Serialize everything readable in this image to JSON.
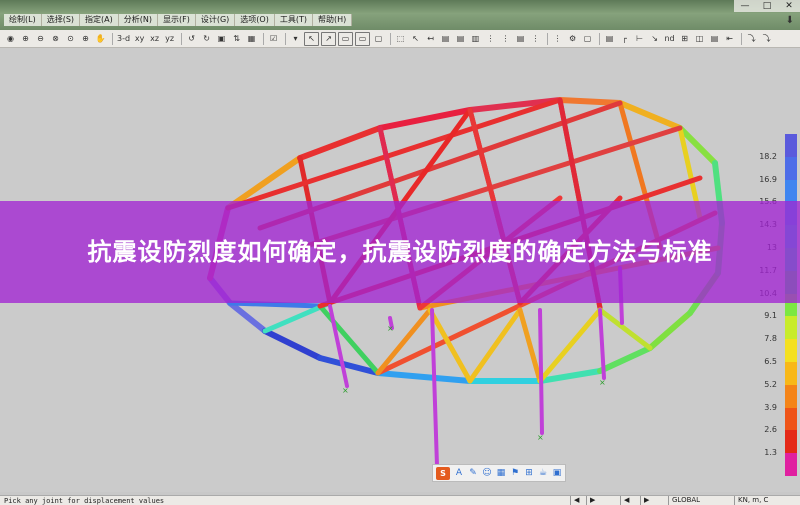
{
  "menubar": {
    "items": [
      "绘制(L)",
      "选择(S)",
      "指定(A)",
      "分析(N)",
      "显示(F)",
      "设计(G)",
      "选项(O)",
      "工具(T)",
      "帮助(H)"
    ],
    "window_controls": [
      "—",
      "□",
      "✕"
    ],
    "download_icon": "download-icon"
  },
  "toolbar": {
    "items": [
      "◉",
      "⊕",
      "⊖",
      "⊗",
      "⊙",
      "⊕",
      "✋",
      "3-d",
      "xy",
      "xz",
      "yz",
      "↺",
      "↻",
      "▣",
      "⇅",
      "▦",
      "☑",
      "▾",
      "↖",
      "↗",
      "▭",
      "▭",
      "▢",
      "⬚",
      "↖",
      "↤",
      "▤",
      "▤",
      "▥",
      "⋮",
      "⋮",
      "▤",
      "⋮",
      "⋮",
      "⚙",
      "▢",
      "▤",
      "┌",
      "⊢",
      "↘",
      "nd",
      "⊞",
      "◫",
      "▤",
      "⇤",
      "⤵",
      "⤵"
    ],
    "view_labels": [
      "3-d",
      "xy",
      "xz",
      "yz"
    ]
  },
  "legend": {
    "values": [
      "18.2",
      "16.9",
      "15.6",
      "14.3",
      "13",
      "11.7",
      "10.4",
      "9.1",
      "7.8",
      "6.5",
      "5.2",
      "3.9",
      "2.6",
      "1.3"
    ],
    "colors": [
      "#5a5adc",
      "#4d6de8",
      "#3f86f0",
      "#2aa2f0",
      "#20c2e0",
      "#28d8b0",
      "#40e070",
      "#7ce840",
      "#c8ec2a",
      "#f4e020",
      "#f8b818",
      "#f48418",
      "#ee5418",
      "#e42818",
      "#e020a0"
    ]
  },
  "banner": {
    "text": "抗震设防烈度如何确定，抗震设防烈度的确定方法与标准"
  },
  "status": {
    "message": "Pick any joint for displacement values",
    "coord_system": "GLOBAL",
    "units": "KN, m, C",
    "nav_arrows": [
      "◀",
      "▶",
      "◀",
      "▶"
    ]
  },
  "minibar": {
    "logo": "S",
    "icons": [
      "A",
      "✎",
      "☺",
      "▦",
      "⚑",
      "⊞",
      "☕",
      "▣"
    ]
  }
}
